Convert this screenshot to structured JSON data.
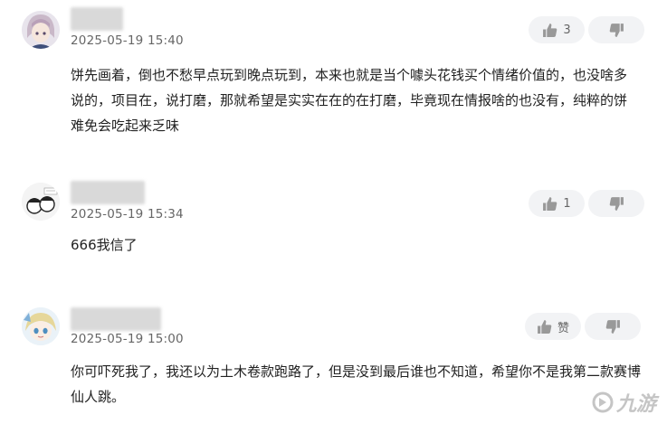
{
  "comments": [
    {
      "time": "2025-05-19 15:40",
      "text": "饼先画着，倒也不愁早点玩到晚点玩到，本来也就是当个噱头花钱买个情绪价值的，也没啥多说的，项目在，说打磨，那就希望是实实在在的在打磨，毕竟现在情报啥的也没有，纯粹的饼难免会吃起来乏味",
      "likes": "3"
    },
    {
      "time": "2025-05-19 15:34",
      "text": "666我信了",
      "likes": "1"
    },
    {
      "time": "2025-05-19 15:00",
      "text": "你可吓死我了，我还以为土木卷款跑路了，但是没到最后谁也不知道，希望你不是我第二款赛博仙人跳。",
      "likes": "赞"
    }
  ],
  "watermark": {
    "text": "九游"
  },
  "icons": {
    "like": "thumbs-up-icon",
    "dislike": "thumbs-down-icon"
  }
}
